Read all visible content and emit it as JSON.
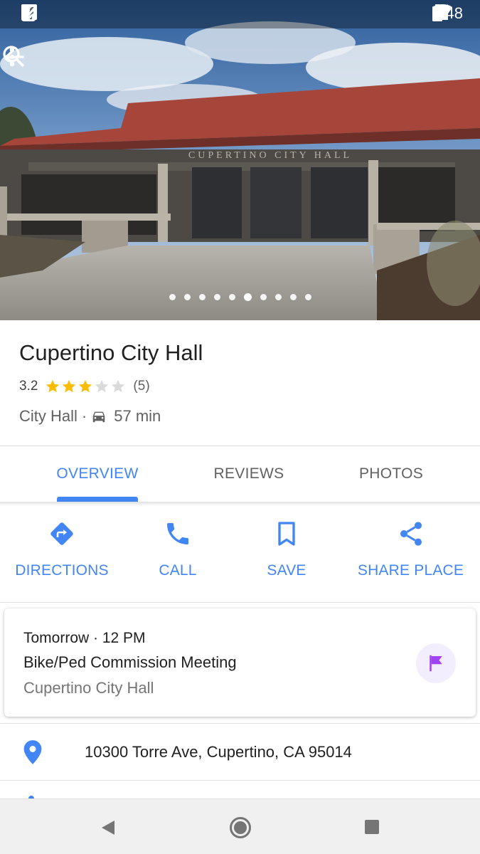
{
  "status_bar": {
    "time": "9:48",
    "left_icons": [
      "facebook-icon",
      "download-icon",
      "check-icon"
    ],
    "right_icons": [
      "location-icon",
      "bluetooth-icon",
      "wifi-icon",
      "signal-icon",
      "battery-icon"
    ]
  },
  "photo": {
    "building_sign": "CUPERTINO CITY HALL",
    "page_count": 10,
    "active_page": 6
  },
  "place": {
    "name": "Cupertino City Hall",
    "rating": "3.2",
    "rating_stars": 3.2,
    "review_count": "(5)",
    "category": "City Hall",
    "separator": "·",
    "drive_time": "57 min"
  },
  "tabs": [
    {
      "label": "OVERVIEW",
      "active": true
    },
    {
      "label": "REVIEWS",
      "active": false
    },
    {
      "label": "PHOTOS",
      "active": false
    }
  ],
  "actions": [
    {
      "label": "DIRECTIONS",
      "icon": "directions-icon"
    },
    {
      "label": "CALL",
      "icon": "phone-icon"
    },
    {
      "label": "SAVE",
      "icon": "bookmark-icon"
    },
    {
      "label": "SHARE PLACE",
      "icon": "share-icon"
    }
  ],
  "event": {
    "when": "Tomorrow · 12 PM",
    "title": "Bike/Ped Commission Meeting",
    "location": "Cupertino City Hall",
    "icon": "flag-icon"
  },
  "address": {
    "text": "10300 Torre Ave, Cupertino, CA 95014",
    "icon": "location-pin-icon"
  },
  "colors": {
    "accent": "#4285f4",
    "star": "#fbbc04",
    "star_empty": "#dadada",
    "flag": "#a142f4"
  }
}
